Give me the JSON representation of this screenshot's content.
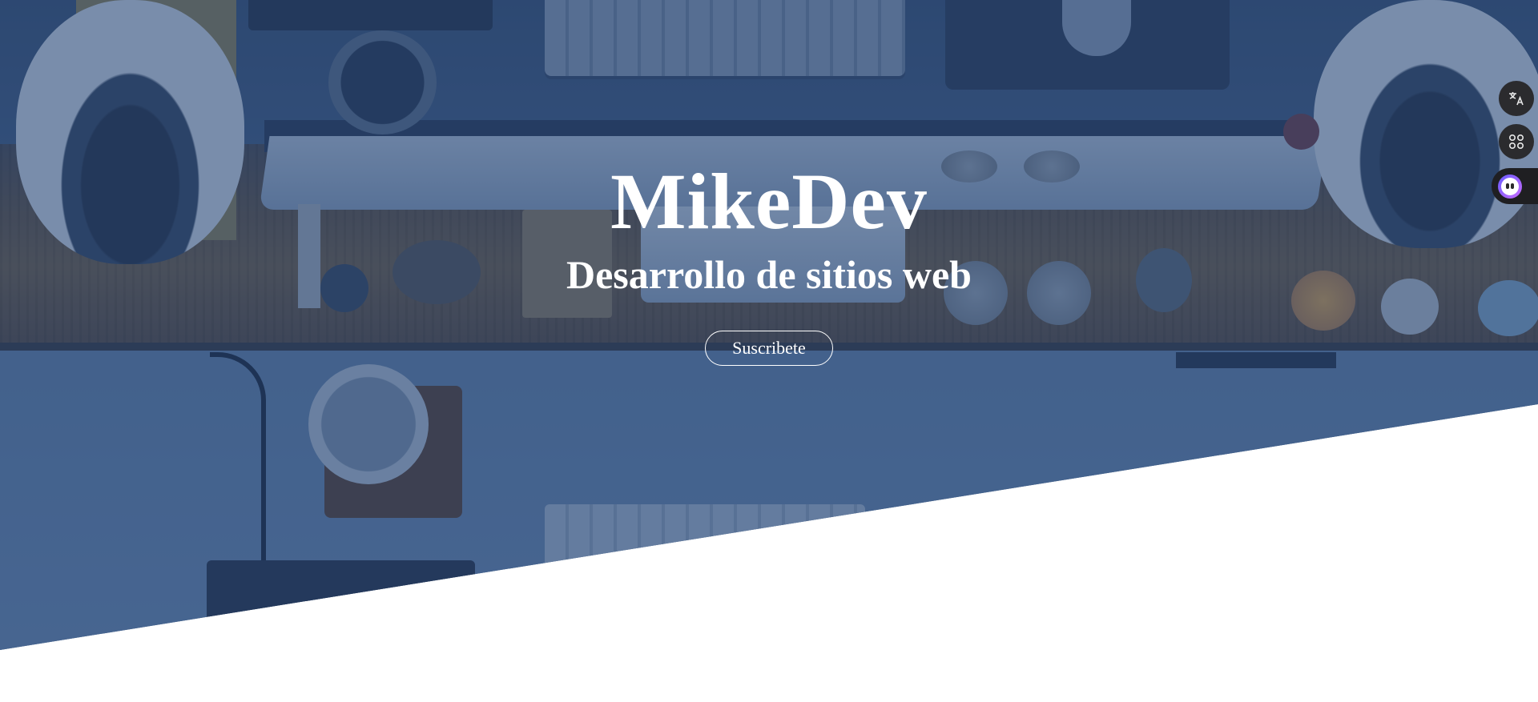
{
  "hero": {
    "brand": "MikeDev",
    "tagline": "Desarrollo de sitios web",
    "cta_label": "Suscribete"
  },
  "side_toolbar": {
    "items": [
      {
        "icon": "translate-icon"
      },
      {
        "icon": "apps-grid-icon"
      },
      {
        "icon": "ai-assistant-icon"
      }
    ]
  },
  "colors": {
    "overlay": "#2b4a7a",
    "text": "#ffffff",
    "page_background": "#ffffff"
  }
}
